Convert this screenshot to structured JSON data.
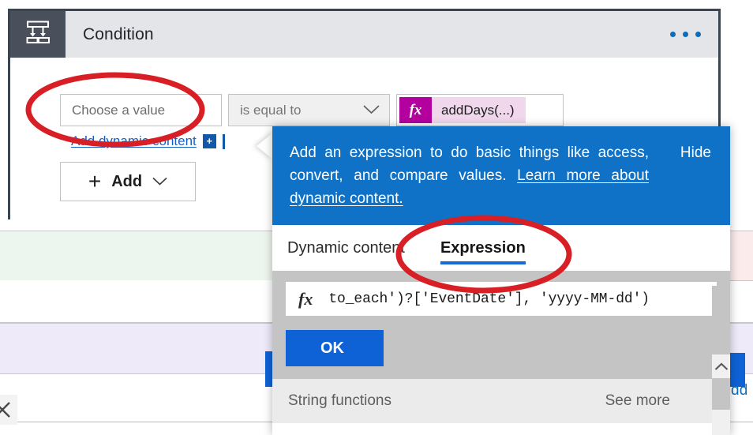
{
  "card": {
    "title": "Condition",
    "icon": "condition-branch-icon",
    "menu_icon": "ellipsis-icon",
    "header_bg": "#e3e5e8",
    "icon_bg": "#4a4f5c",
    "border_color": "#3b4552"
  },
  "condition_row": {
    "choose_value_placeholder": "Choose a value",
    "operator_value": "is equal to",
    "operator_chevron": "chevron-down-icon",
    "value_token_badge": "fx",
    "value_token_label": "addDays(...)",
    "token_badge_color": "#b4009e",
    "token_label_bg": "#f0d7ec"
  },
  "dynamic_content": {
    "link_label": "Add dynamic content",
    "plus_badge": "+",
    "link_color": "#1262c4"
  },
  "add_button": {
    "plus": "+",
    "label": "Add",
    "chevron": "⌄"
  },
  "panel": {
    "banner": {
      "text_part1": "Add an expression to do basic things like access, convert, and compare values. ",
      "link_text": "Learn more about dynamic content.",
      "hide_label": "Hide",
      "bg": "#0f72c6"
    },
    "tabs": [
      {
        "label": "Dynamic content",
        "selected": false
      },
      {
        "label": "Expression",
        "selected": true
      }
    ],
    "expression": {
      "fx_glyph": "fx",
      "value": "to_each')?['EventDate'], 'yyyy-MM-dd')",
      "ok_label": "OK",
      "ok_color": "#0f62d6"
    },
    "functions_bar": {
      "category": "String functions",
      "see_more": "See more"
    },
    "scroll_up_icon": "chevron-up-icon"
  },
  "background": {
    "add_link_peek": "dd",
    "close_icon": "close-x-icon",
    "green_row_color": "#edf6ee",
    "purple_row_color": "#eeeafa",
    "pink_row_color": "#fbebeb"
  },
  "annotations": {
    "ellipse_color": "#d81f26",
    "ellipse_1_target": "choose-a-value-field",
    "ellipse_2_target": "expression-tab"
  }
}
